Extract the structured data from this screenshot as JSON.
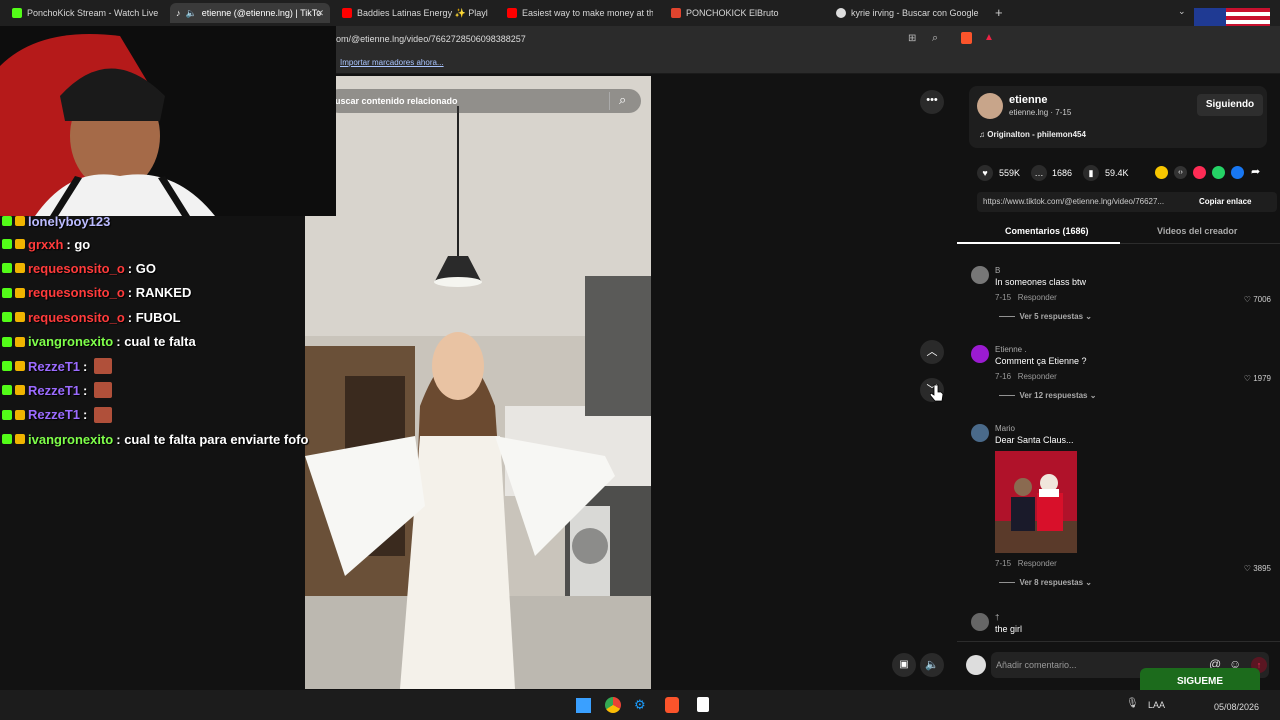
{
  "tabs": [
    {
      "label": "PonchoKick Stream - Watch Live on",
      "color": "#53fc18"
    },
    {
      "label": "etienne (@etienne.lng) | TikTo",
      "color": "#ffffff"
    },
    {
      "label": "Baddies Latinas Energy ✨ Playlist (",
      "color": "#ff0000"
    },
    {
      "label": "Easiest way to make money at the ca",
      "color": "#ff0000"
    },
    {
      "label": "PONCHOKICK ElBruto",
      "color": "#e0442e"
    },
    {
      "label": "kyrie irving - Buscar con Google",
      "color": "#cccccc"
    }
  ],
  "url": "om/@etienne.lng/video/7662728506098388257",
  "bookmarks_link": "Importar marcadores ahora...",
  "search_placeholder": "uscar contenido relacionado",
  "chat": [
    {
      "user": "lonelyboy123",
      "user_color": "#bbbbff",
      "msg": ""
    },
    {
      "user": "grxxh",
      "user_color": "#ff3b3b",
      "msg": ": go"
    },
    {
      "user": "requesonsito_o",
      "user_color": "#ff3b3b",
      "msg": ": GO"
    },
    {
      "user": "requesonsito_o",
      "user_color": "#ff3b3b",
      "msg": ": RANKED"
    },
    {
      "user": "requesonsito_o",
      "user_color": "#ff3b3b",
      "msg": ": FUBOL"
    },
    {
      "user": "ivangronexito",
      "user_color": "#7fff4a",
      "msg": ": cual te falta"
    },
    {
      "user": "RezzeT1",
      "user_color": "#9b6bff",
      "msg": ":"
    },
    {
      "user": "RezzeT1",
      "user_color": "#9b6bff",
      "msg": ":"
    },
    {
      "user": "RezzeT1",
      "user_color": "#9b6bff",
      "msg": ":"
    },
    {
      "user": "ivangronexito",
      "user_color": "#7fff4a",
      "msg": ": cual te falta para enviarte fofo"
    }
  ],
  "creator": {
    "name": "etienne",
    "handle": "etienne.lng · 7-15",
    "follow_label": "Siguiendo",
    "sound": "Originalton - philemon454"
  },
  "actions": {
    "likes": "559K",
    "comments": "1686",
    "saves": "59.4K"
  },
  "share": {
    "link": "https://www.tiktok.com/@etienne.lng/video/76627...",
    "copy_label": "Copiar enlace"
  },
  "panel_tabs": {
    "comments": "Comentarios (1686)",
    "creator_videos": "Videos del creador"
  },
  "comments": [
    {
      "name": "B",
      "text": "In someones class btw",
      "date": "7-15",
      "reply": "Responder",
      "likes": "7006",
      "replies": "Ver 5 respuestas"
    },
    {
      "name": "Etienne .",
      "text": "Comment ça Etienne ?",
      "date": "7-16",
      "reply": "Responder",
      "likes": "1979",
      "replies": "Ver 12 respuestas"
    },
    {
      "name": "Mario",
      "text": "Dear Santa Claus...",
      "date": "7-15",
      "reply": "Responder",
      "likes": "3895",
      "replies": "Ver 8 respuestas"
    },
    {
      "name": "†",
      "text": "the girl"
    }
  ],
  "add_comment_placeholder": "Añadir comentario...",
  "overlay_follow": "SIGUEME",
  "taskbar": {
    "lang": "LAA",
    "date": "05/08/2026"
  },
  "colors": {
    "accent": "#fe2c55",
    "kick_green": "#53fc18"
  }
}
